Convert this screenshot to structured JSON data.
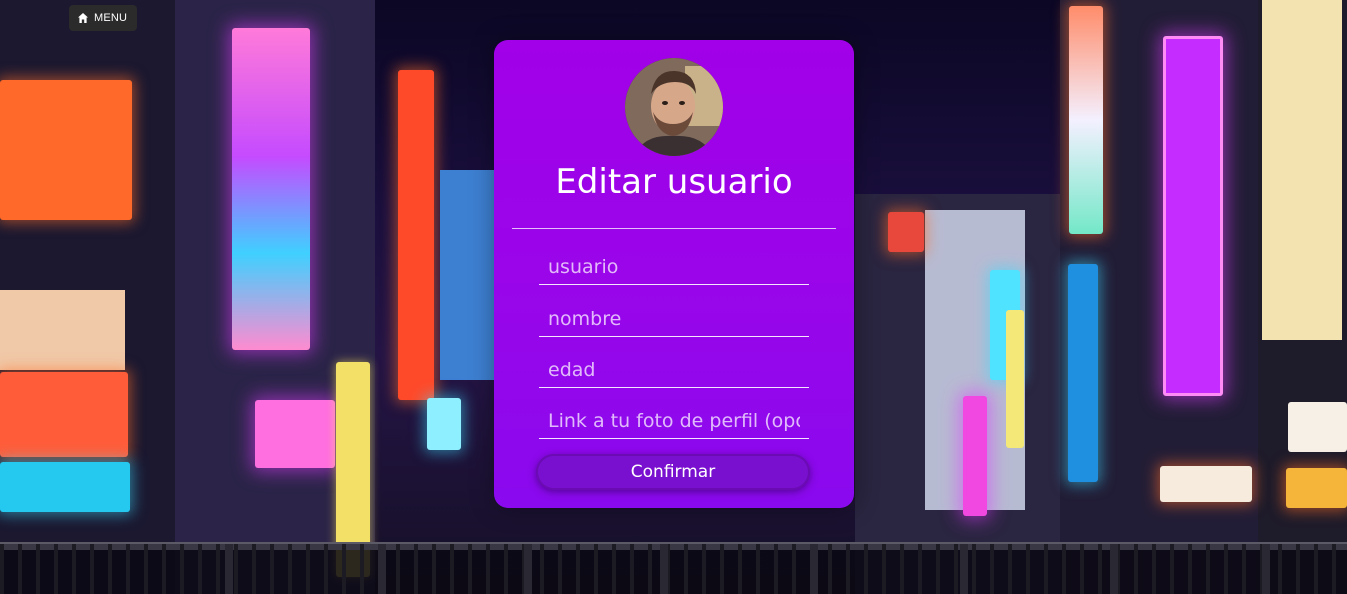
{
  "menu": {
    "label": "MENU",
    "icon": "home-icon"
  },
  "card": {
    "avatar_alt": "",
    "title": "Editar usuario",
    "fields": {
      "username_placeholder": "usuario",
      "name_placeholder": "nombre",
      "age_placeholder": "edad",
      "photo_placeholder": "Link a tu foto de perfil (opcional)"
    },
    "confirm_label": "Confirmar"
  },
  "colors": {
    "card_top": "#a100e8",
    "card_bottom": "#8a09ee",
    "button": "#7a10cf",
    "menu_bg": "#2b2b2b"
  }
}
